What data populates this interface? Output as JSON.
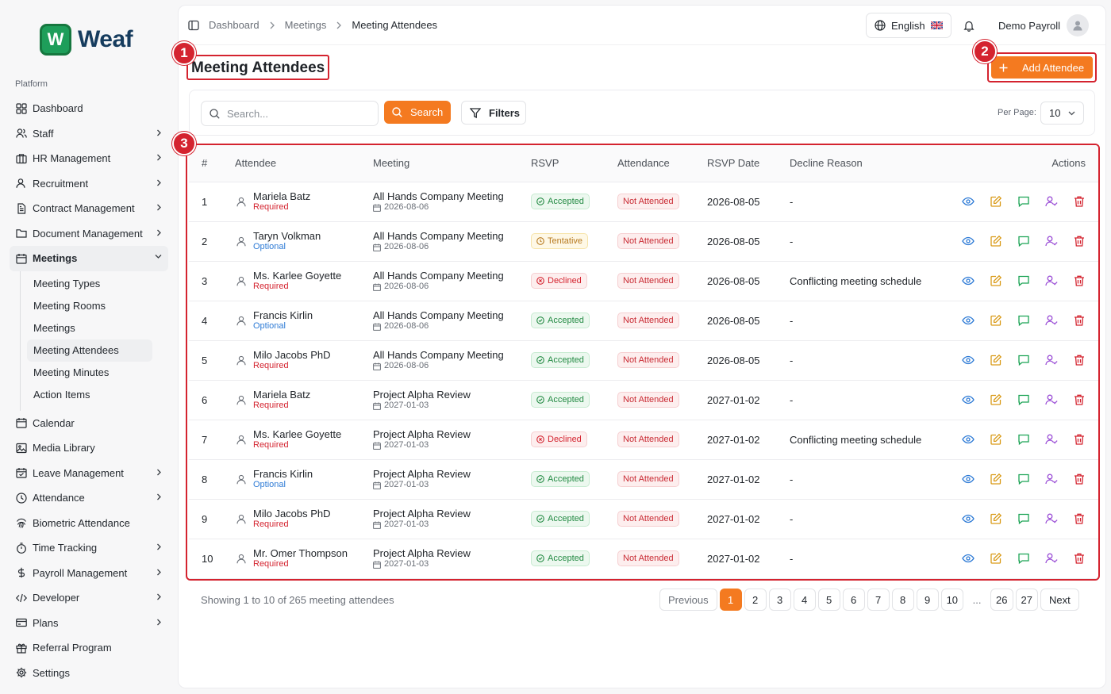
{
  "brand": {
    "logo_letter": "W",
    "name": "Weaf"
  },
  "sidebar": {
    "section_label": "Platform",
    "items": [
      {
        "label": "Dashboard",
        "icon": "grid-icon",
        "chevron": false
      },
      {
        "label": "Staff",
        "icon": "users-icon",
        "chevron": true
      },
      {
        "label": "HR Management",
        "icon": "briefcase-icon",
        "chevron": true
      },
      {
        "label": "Recruitment",
        "icon": "user-plus-icon",
        "chevron": true
      },
      {
        "label": "Contract Management",
        "icon": "file-icon",
        "chevron": true
      },
      {
        "label": "Document Management",
        "icon": "folder-icon",
        "chevron": true
      },
      {
        "label": "Meetings",
        "icon": "calendar-icon",
        "chevron": true,
        "open": true
      }
    ],
    "meetings_subitems": [
      "Meeting Types",
      "Meeting Rooms",
      "Meetings",
      "Meeting Attendees",
      "Meeting Minutes",
      "Action Items"
    ],
    "items_after": [
      {
        "label": "Calendar",
        "icon": "calendar-icon",
        "chevron": false
      },
      {
        "label": "Media Library",
        "icon": "image-icon",
        "chevron": false
      },
      {
        "label": "Leave Management",
        "icon": "calendar-check-icon",
        "chevron": true
      },
      {
        "label": "Attendance",
        "icon": "clock-icon",
        "chevron": true
      },
      {
        "label": "Biometric Attendance",
        "icon": "fingerprint-icon",
        "chevron": false
      },
      {
        "label": "Time Tracking",
        "icon": "timer-icon",
        "chevron": true
      },
      {
        "label": "Payroll Management",
        "icon": "dollar-icon",
        "chevron": true
      },
      {
        "label": "Developer",
        "icon": "code-icon",
        "chevron": true
      },
      {
        "label": "Plans",
        "icon": "credit-card-icon",
        "chevron": true
      },
      {
        "label": "Referral Program",
        "icon": "gift-icon",
        "chevron": false
      },
      {
        "label": "Settings",
        "icon": "gear-icon",
        "chevron": false
      }
    ]
  },
  "header": {
    "breadcrumb": [
      "Dashboard",
      "Meetings",
      "Meeting Attendees"
    ],
    "language": "English",
    "user_name": "Demo Payroll"
  },
  "page": {
    "title": "Meeting Attendees",
    "add_button": "Add Attendee",
    "markers": [
      "1",
      "2",
      "3"
    ]
  },
  "toolbar": {
    "search_placeholder": "Search...",
    "search_button": "Search",
    "filters_button": "Filters",
    "per_page_label": "Per Page:",
    "per_page_value": "10"
  },
  "table": {
    "columns": [
      "#",
      "Attendee",
      "Meeting",
      "RSVP",
      "Attendance",
      "RSVP Date",
      "Decline Reason",
      "Actions"
    ],
    "rows": [
      {
        "num": "1",
        "name": "Mariela Batz",
        "type": "Required",
        "meeting": "All Hands Company Meeting",
        "meeting_date": "2026-08-06",
        "rsvp": "Accepted",
        "attendance": "Not Attended",
        "rsvp_date": "2026-08-05",
        "reason": "-"
      },
      {
        "num": "2",
        "name": "Taryn Volkman",
        "type": "Optional",
        "meeting": "All Hands Company Meeting",
        "meeting_date": "2026-08-06",
        "rsvp": "Tentative",
        "attendance": "Not Attended",
        "rsvp_date": "2026-08-05",
        "reason": "-"
      },
      {
        "num": "3",
        "name": "Ms. Karlee Goyette",
        "type": "Required",
        "meeting": "All Hands Company Meeting",
        "meeting_date": "2026-08-06",
        "rsvp": "Declined",
        "attendance": "Not Attended",
        "rsvp_date": "2026-08-05",
        "reason": "Conflicting meeting schedule"
      },
      {
        "num": "4",
        "name": "Francis Kirlin",
        "type": "Optional",
        "meeting": "All Hands Company Meeting",
        "meeting_date": "2026-08-06",
        "rsvp": "Accepted",
        "attendance": "Not Attended",
        "rsvp_date": "2026-08-05",
        "reason": "-"
      },
      {
        "num": "5",
        "name": "Milo Jacobs PhD",
        "type": "Required",
        "meeting": "All Hands Company Meeting",
        "meeting_date": "2026-08-06",
        "rsvp": "Accepted",
        "attendance": "Not Attended",
        "rsvp_date": "2026-08-05",
        "reason": "-"
      },
      {
        "num": "6",
        "name": "Mariela Batz",
        "type": "Required",
        "meeting": "Project Alpha Review",
        "meeting_date": "2027-01-03",
        "rsvp": "Accepted",
        "attendance": "Not Attended",
        "rsvp_date": "2027-01-02",
        "reason": "-"
      },
      {
        "num": "7",
        "name": "Ms. Karlee Goyette",
        "type": "Required",
        "meeting": "Project Alpha Review",
        "meeting_date": "2027-01-03",
        "rsvp": "Declined",
        "attendance": "Not Attended",
        "rsvp_date": "2027-01-02",
        "reason": "Conflicting meeting schedule"
      },
      {
        "num": "8",
        "name": "Francis Kirlin",
        "type": "Optional",
        "meeting": "Project Alpha Review",
        "meeting_date": "2027-01-03",
        "rsvp": "Accepted",
        "attendance": "Not Attended",
        "rsvp_date": "2027-01-02",
        "reason": "-"
      },
      {
        "num": "9",
        "name": "Milo Jacobs PhD",
        "type": "Required",
        "meeting": "Project Alpha Review",
        "meeting_date": "2027-01-03",
        "rsvp": "Accepted",
        "attendance": "Not Attended",
        "rsvp_date": "2027-01-02",
        "reason": "-"
      },
      {
        "num": "10",
        "name": "Mr. Omer Thompson",
        "type": "Required",
        "meeting": "Project Alpha Review",
        "meeting_date": "2027-01-03",
        "rsvp": "Accepted",
        "attendance": "Not Attended",
        "rsvp_date": "2027-01-02",
        "reason": "-"
      }
    ]
  },
  "pagination": {
    "summary": "Showing 1 to 10 of 265 meeting attendees",
    "previous": "Previous",
    "next": "Next",
    "pages": [
      "1",
      "2",
      "3",
      "4",
      "5",
      "6",
      "7",
      "8",
      "9",
      "10",
      "...",
      "26",
      "27"
    ],
    "current": "1"
  },
  "colors": {
    "accent": "#f47a20",
    "annotation": "#d4232f",
    "required": "#d4232f",
    "optional": "#2e7bd6"
  }
}
